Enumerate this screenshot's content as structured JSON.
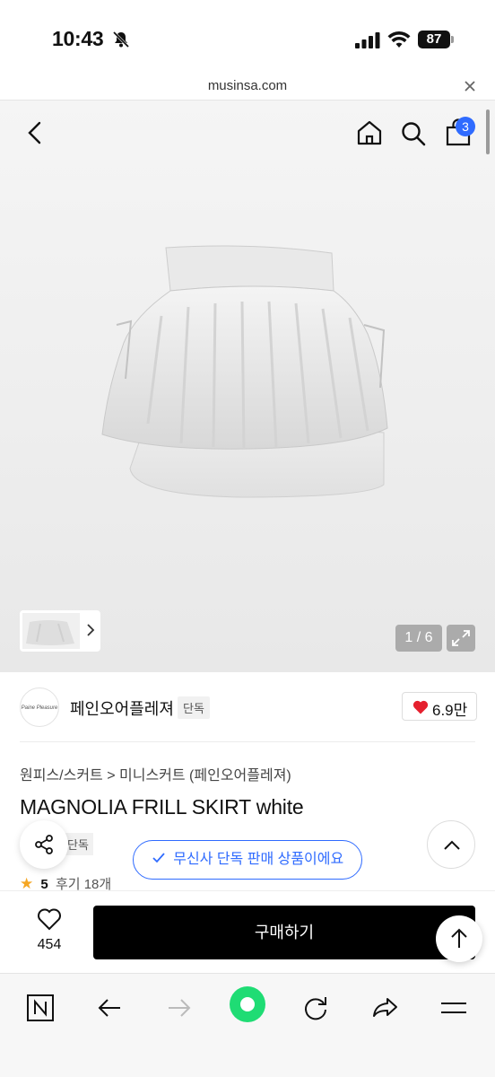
{
  "status_bar": {
    "time": "10:43",
    "battery": "87"
  },
  "browser": {
    "url": "musinsa.com"
  },
  "header": {
    "cart_count": "3"
  },
  "gallery": {
    "counter": "1 / 6"
  },
  "brand": {
    "logo_text": "Paine Pleasure",
    "name": "페인오어플레져",
    "exclusive_label": "단독",
    "likes": "6.9만"
  },
  "product": {
    "breadcrumb": "원피스/스커트 > 미니스커트 (페인오어플레져)",
    "title": "MAGNOLIA FRILL SKIRT white",
    "tag_label": "단독",
    "rating_score": "5",
    "review_text": "후기 18개",
    "exclusive_toast": "무신사 단독 판매 상품이에요"
  },
  "action_bar": {
    "wish_count": "454",
    "buy_label": "구매하기"
  },
  "colors": {
    "accent": "#2f6bff",
    "buy_button": "#000000",
    "heart": "#e5202e",
    "browser_green": "#1fdc74"
  }
}
